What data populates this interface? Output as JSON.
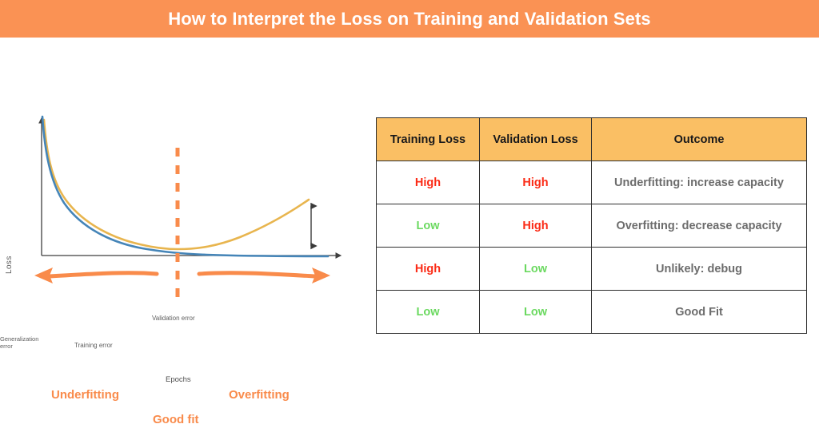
{
  "header": {
    "title": "How to Interpret the Loss on Training and Validation Sets",
    "bg_color": "#fa9254",
    "text_color": "#ffffff"
  },
  "figure": {
    "y_axis_label": "Loss",
    "x_axis_label": "Epochs",
    "curve_labels": {
      "validation": "Validation error",
      "training": "Training error"
    },
    "annotation": {
      "generalization_line1": "Generalization",
      "generalization_line2": "error"
    },
    "regions": {
      "left": "Underfitting",
      "right": "Overfitting",
      "center": "Good fit"
    },
    "colors": {
      "training_curve": "#4585b8",
      "validation_curve": "#e8b54e",
      "divider": "#f98b4b",
      "region_label": "#f98b4b",
      "axis": "#3f3f3f"
    }
  },
  "table": {
    "columns": [
      "Training Loss",
      "Validation Loss",
      "Outcome"
    ],
    "header_bg": "#fabf64",
    "high_color": "#fb2b16",
    "low_color": "#6bd960",
    "outcome_color": "#6c6c6c",
    "rows": [
      {
        "training": "High",
        "validation": "High",
        "outcome": "Underfitting: increase capacity"
      },
      {
        "training": "Low",
        "validation": "High",
        "outcome": "Overfitting: decrease capacity"
      },
      {
        "training": "High",
        "validation": "Low",
        "outcome": "Unlikely: debug"
      },
      {
        "training": "Low",
        "validation": "Low",
        "outcome": "Good Fit"
      }
    ]
  },
  "chart_data": {
    "type": "line",
    "title": "Training and Validation Loss vs Epochs",
    "xlabel": "Epochs",
    "ylabel": "Loss",
    "grid": false,
    "legend": "inline-annotations",
    "xlim": [
      0,
      100
    ],
    "ylim": [
      0,
      100
    ],
    "annotations": [
      {
        "text": "Validation error",
        "x": 42,
        "y": 35
      },
      {
        "text": "Training error",
        "x": 18,
        "y": 16
      },
      {
        "text": "Generalization error",
        "x": 93,
        "y": 27
      },
      {
        "text": "Good fit",
        "x": 47,
        "y": 0,
        "type": "vertical-divider"
      },
      {
        "text": "Underfitting",
        "x": 22,
        "y": -10,
        "type": "region-arrow-left"
      },
      {
        "text": "Overfitting",
        "x": 74,
        "y": -10,
        "type": "region-arrow-right"
      }
    ],
    "series": [
      {
        "name": "Training error",
        "color": "#4585b8",
        "x": [
          0,
          2,
          5,
          10,
          15,
          20,
          25,
          30,
          35,
          40,
          47,
          55,
          65,
          75,
          85,
          95,
          100
        ],
        "y": [
          100,
          72,
          55,
          42,
          34,
          28,
          24,
          21,
          18,
          16,
          13,
          11,
          9,
          8,
          7,
          6.5,
          6
        ]
      },
      {
        "name": "Validation error",
        "color": "#e8b54e",
        "x": [
          0,
          2,
          5,
          10,
          15,
          20,
          25,
          30,
          35,
          40,
          47,
          55,
          65,
          75,
          85,
          95,
          100
        ],
        "y": [
          98,
          80,
          64,
          51,
          43,
          37,
          33,
          30,
          28,
          26.5,
          25.5,
          26,
          29,
          34,
          41,
          49,
          53
        ]
      }
    ]
  }
}
